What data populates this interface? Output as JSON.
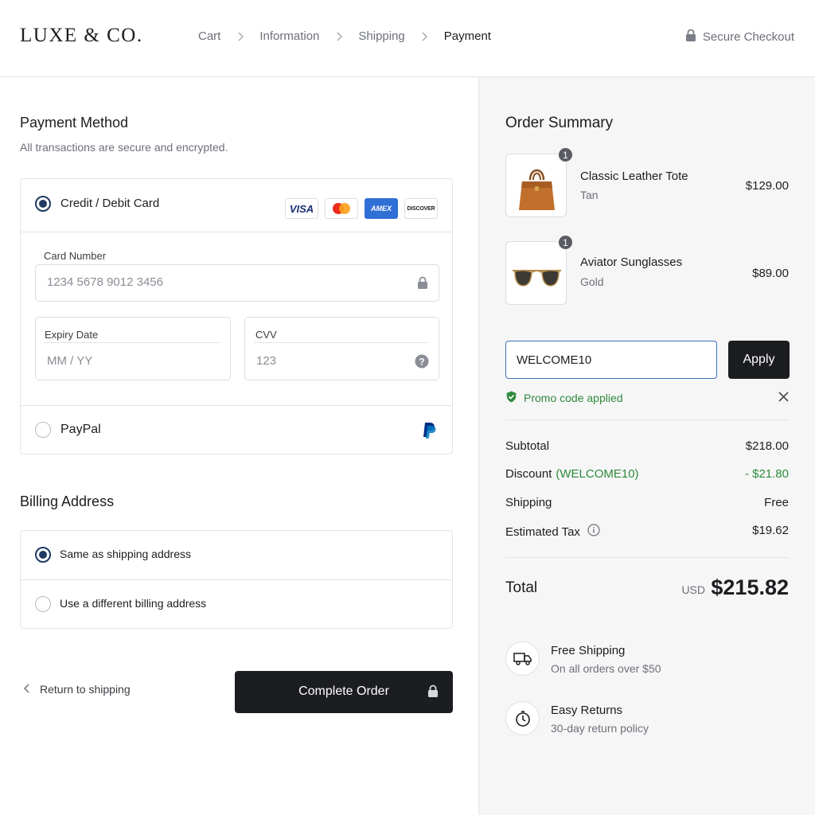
{
  "header": {
    "logo": "LUXE & CO.",
    "breadcrumbs": [
      {
        "label": "Cart"
      },
      {
        "label": "Information"
      },
      {
        "label": "Shipping"
      },
      {
        "label": "Payment"
      }
    ],
    "secure_label": "Secure Checkout"
  },
  "payment": {
    "title": "Payment Method",
    "subtitle": "All transactions are secure and encrypted.",
    "card_option_label": "Credit / Debit Card",
    "brands": [
      "VISA",
      "mastercard",
      "AMEX",
      "DISCOVER"
    ],
    "card_number": {
      "label": "Card Number",
      "placeholder": "1234 5678 9012 3456",
      "value": ""
    },
    "expiry": {
      "label": "Expiry Date",
      "placeholder": "MM / YY",
      "value": ""
    },
    "cvv": {
      "label": "CVV",
      "placeholder": "123",
      "value": ""
    },
    "paypal_label": "PayPal",
    "selected": "card"
  },
  "billing": {
    "title": "Billing Address",
    "options": [
      {
        "label": "Same as shipping address",
        "selected": true
      },
      {
        "label": "Use a different billing address",
        "selected": false
      }
    ]
  },
  "actions": {
    "return_label": "Return to shipping",
    "complete_label": "Complete Order"
  },
  "summary": {
    "title": "Order Summary",
    "items": [
      {
        "name": "Classic Leather Tote",
        "variant": "Tan",
        "price": "$129.00",
        "qty": "1"
      },
      {
        "name": "Aviator Sunglasses",
        "variant": "Gold",
        "price": "$89.00",
        "qty": "1"
      }
    ],
    "promo": {
      "value": "WELCOME10",
      "apply_label": "Apply",
      "status": "Promo code applied"
    },
    "lines": {
      "subtotal_label": "Subtotal",
      "subtotal_value": "$218.00",
      "discount_label": "Discount",
      "discount_code": "(WELCOME10)",
      "discount_value": "- $21.80",
      "shipping_label": "Shipping",
      "shipping_value": "Free",
      "tax_label": "Estimated Tax",
      "tax_value": "$19.62"
    },
    "total": {
      "label": "Total",
      "currency": "USD",
      "value": "$215.82"
    },
    "perks": [
      {
        "title": "Free Shipping",
        "subtitle": "On all orders over $50",
        "icon": "truck-icon"
      },
      {
        "title": "Easy Returns",
        "subtitle": "30-day return policy",
        "icon": "clock-icon"
      }
    ]
  },
  "colors": {
    "accent": "#1f3a63",
    "dark": "#1c1d21",
    "success": "#2f8a3f",
    "focus": "#3b6fb8",
    "panel": "#f6f6f6"
  }
}
